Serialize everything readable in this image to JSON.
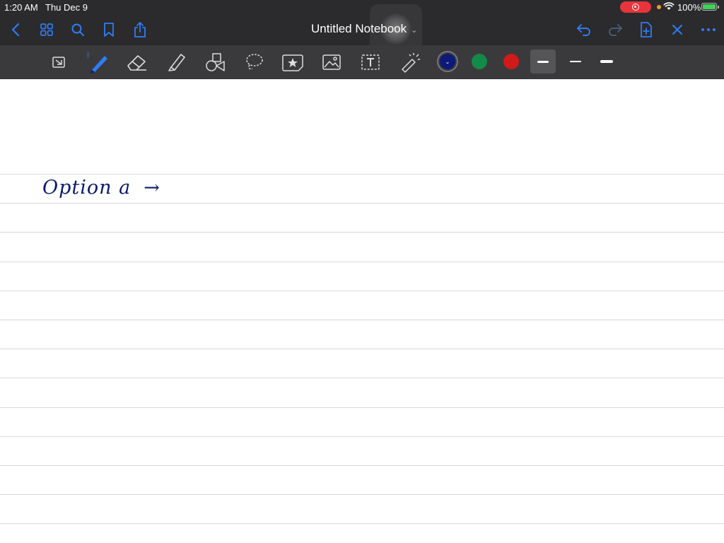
{
  "status_bar": {
    "time": "1:20 AM",
    "date": "Thu Dec 9",
    "battery": "100%"
  },
  "nav": {
    "title": "Untitled Notebook"
  },
  "toolbar": {
    "tools": [
      "keyboard-scroll",
      "pen",
      "eraser",
      "highlighter",
      "shapes",
      "lasso",
      "sticker",
      "image",
      "text",
      "laser-pointer"
    ],
    "colors": [
      "#0d1a7a",
      "#138a48",
      "#d11a1a"
    ],
    "selected_color": "#0d1a7a",
    "thickness_options": 3
  },
  "notebook": {
    "handwritten_text": "Option a",
    "arrow_glyph": "→"
  }
}
